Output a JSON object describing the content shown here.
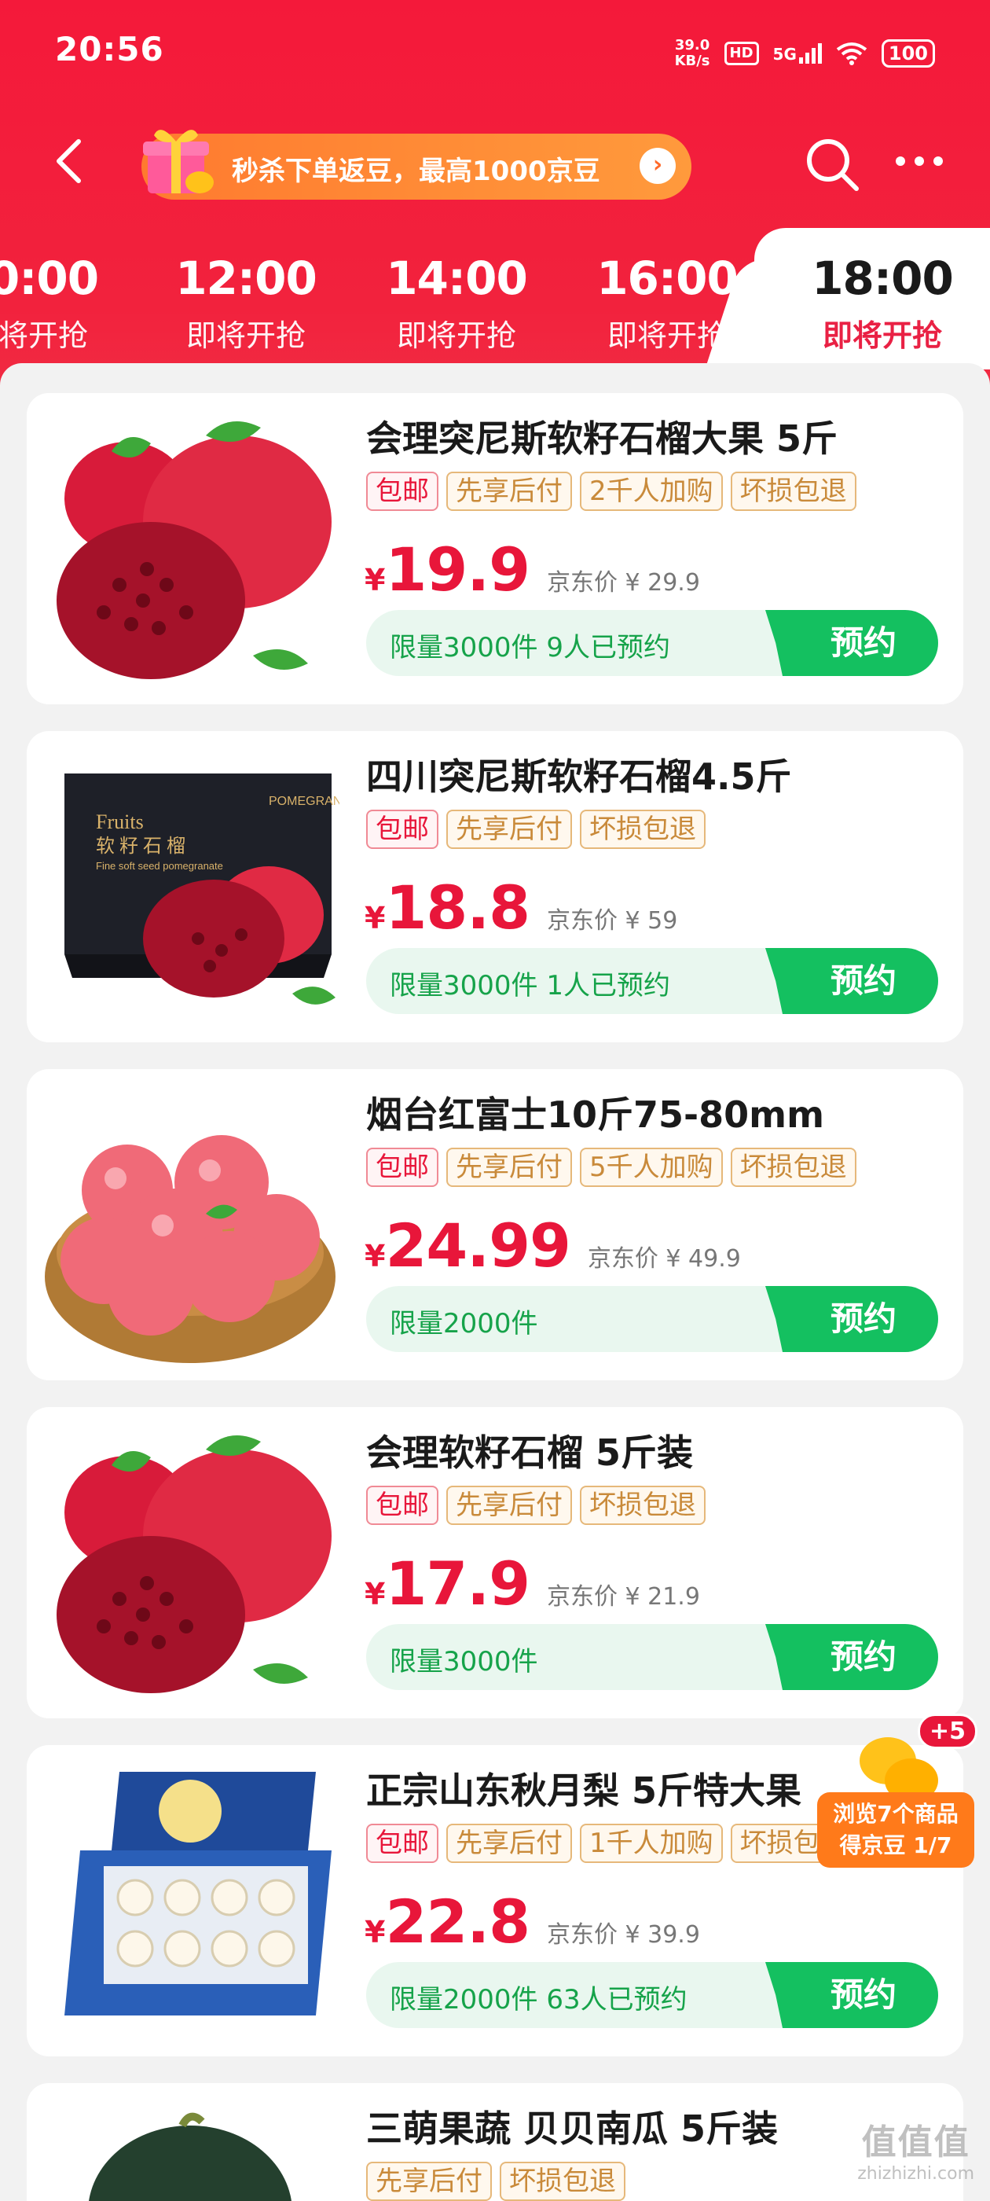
{
  "status_bar": {
    "time": "20:56",
    "net_speed_value": "39.0",
    "net_speed_unit": "KB/s",
    "hd": "HD",
    "network": "5G",
    "battery": "100"
  },
  "nav": {
    "promo_text": "秒杀下单返豆，最高1000京豆"
  },
  "time_tabs": [
    {
      "time": "0:00",
      "status": "将开抢"
    },
    {
      "time": "12:00",
      "status": "即将开抢"
    },
    {
      "time": "14:00",
      "status": "即将开抢"
    },
    {
      "time": "16:00",
      "status": "即将开抢"
    },
    {
      "time": "18:00",
      "status": "即将开抢",
      "active": true
    }
  ],
  "products": [
    {
      "title": "会理突尼斯软籽石榴大果 5斤",
      "tags": [
        "包邮",
        "先享后付",
        "2千人加购",
        "坏损包退"
      ],
      "price_symbol": "¥",
      "price": "19.9",
      "jd_price": "京东价 ¥ 29.9",
      "stock": "限量3000件 9人已预约",
      "button": "预约",
      "image": "pomegranate-image"
    },
    {
      "title": "四川突尼斯软籽石榴4.5斤",
      "tags": [
        "包邮",
        "先享后付",
        "坏损包退"
      ],
      "price_symbol": "¥",
      "price": "18.8",
      "jd_price": "京东价 ¥ 59",
      "stock": "限量3000件 1人已预约",
      "button": "预约",
      "image": "pomegranate-gift-box-image",
      "box_text": {
        "brand": "POMEGRANATE",
        "line1": "Fruits",
        "line2": "软 籽 石 榴",
        "line3": "Fine soft seed pomegranate"
      }
    },
    {
      "title": "烟台红富士10斤75-80mm",
      "tags": [
        "包邮",
        "先享后付",
        "5千人加购",
        "坏损包退"
      ],
      "price_symbol": "¥",
      "price": "24.99",
      "jd_price": "京东价 ¥ 49.9",
      "stock": "限量2000件",
      "button": "预约",
      "image": "apple-basket-image"
    },
    {
      "title": "会理软籽石榴 5斤装",
      "tags": [
        "包邮",
        "先享后付",
        "坏损包退"
      ],
      "price_symbol": "¥",
      "price": "17.9",
      "jd_price": "京东价 ¥ 21.9",
      "stock": "限量3000件",
      "button": "预约",
      "image": "pomegranate-image"
    },
    {
      "title": "正宗山东秋月梨 5斤特大果",
      "tags": [
        "包邮",
        "先享后付",
        "1千人加购",
        "坏损包退"
      ],
      "price_symbol": "¥",
      "price": "22.8",
      "jd_price": "京东价 ¥ 39.9",
      "stock": "限量2000件 63人已预约",
      "button": "预约",
      "image": "pear-gift-box-image"
    },
    {
      "title": "三萌果蔬 贝贝南瓜 5斤装",
      "tags": [
        "先享后付",
        "坏损包退"
      ],
      "image": "pumpkin-image"
    }
  ],
  "bean_float": {
    "plus": "+5",
    "line1": "浏览7个商品",
    "line2": "得京豆 1/7"
  },
  "watermark": {
    "big": "值值值",
    "small": "zhizhizhi.com"
  },
  "colors": {
    "brand_red": "#f2223d",
    "price_red": "#e8163a",
    "book_green": "#14c060",
    "tag_orange": "#c98a3a"
  }
}
